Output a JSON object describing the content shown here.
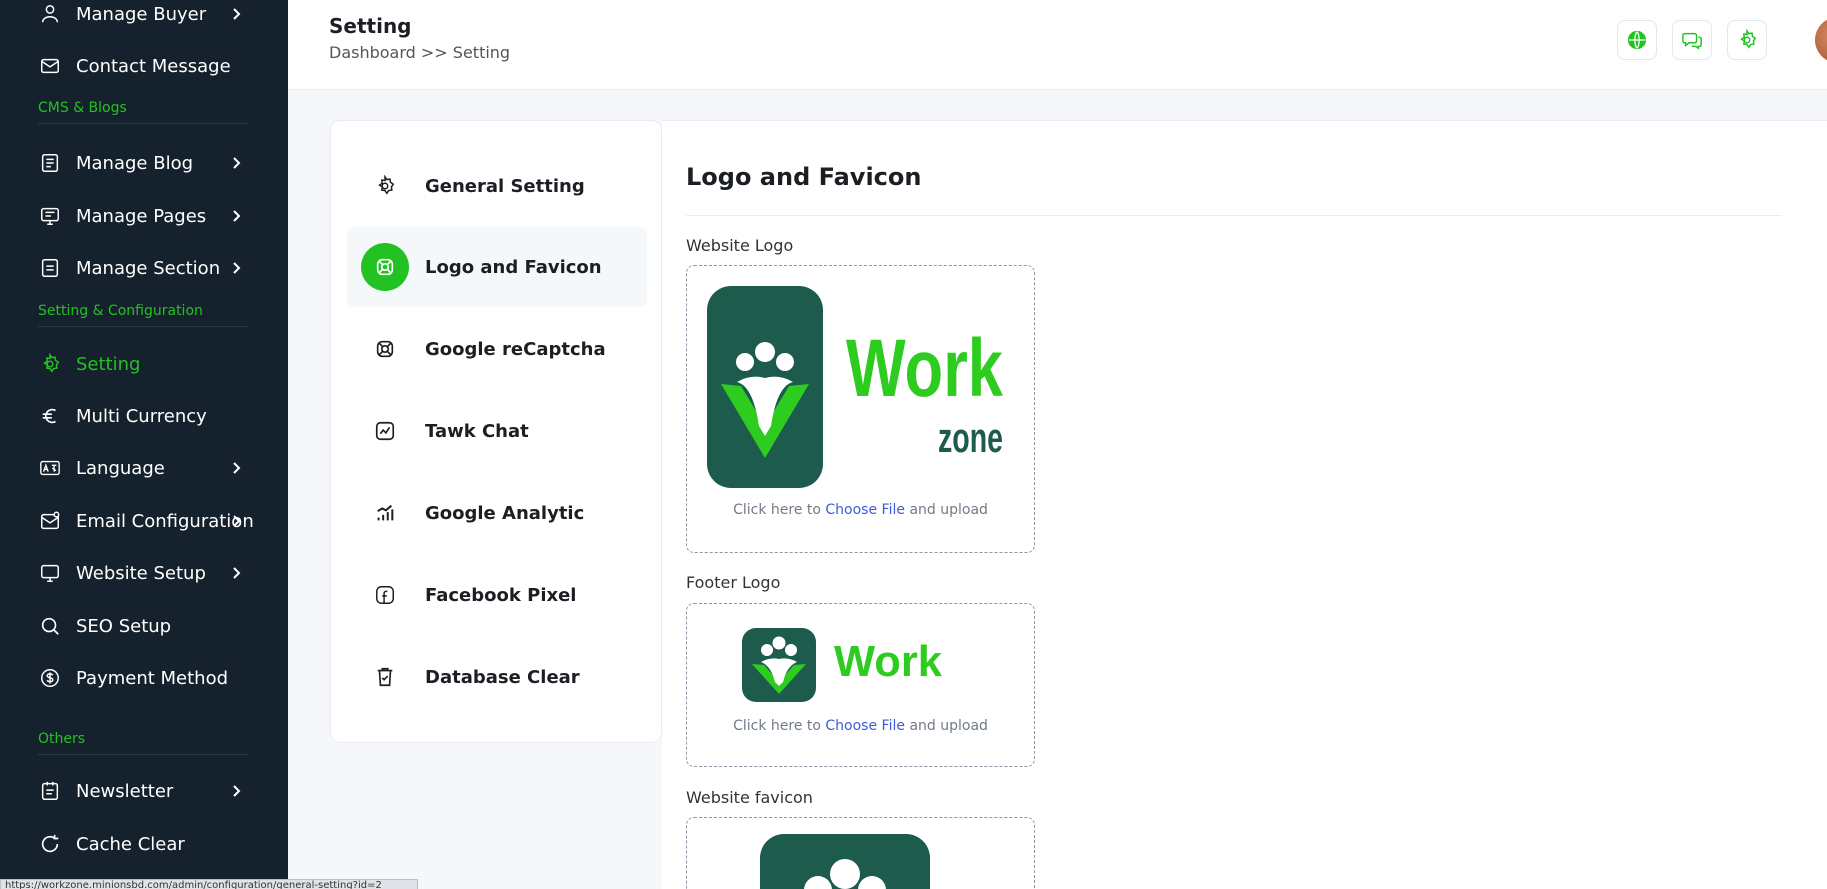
{
  "sidebar": {
    "items": [
      {
        "label": "Manage Buyer",
        "icon": "user-icon",
        "has_chevron": true
      },
      {
        "label": "Contact Message",
        "icon": "mail-icon",
        "has_chevron": false
      },
      {
        "label": "Manage Blog",
        "icon": "blog-icon",
        "has_chevron": true
      },
      {
        "label": "Manage Pages",
        "icon": "pages-icon",
        "has_chevron": true
      },
      {
        "label": "Manage Section",
        "icon": "section-icon",
        "has_chevron": true
      },
      {
        "label": "Setting",
        "icon": "gear-icon",
        "has_chevron": false,
        "active": true
      },
      {
        "label": "Multi Currency",
        "icon": "euro-icon",
        "has_chevron": false
      },
      {
        "label": "Language",
        "icon": "language-icon",
        "has_chevron": true
      },
      {
        "label": "Email Configuration",
        "icon": "email-config-icon",
        "has_chevron": true
      },
      {
        "label": "Website Setup",
        "icon": "monitor-icon",
        "has_chevron": true
      },
      {
        "label": "SEO Setup",
        "icon": "search-icon",
        "has_chevron": false
      },
      {
        "label": "Payment Method",
        "icon": "dollar-icon",
        "has_chevron": false
      },
      {
        "label": "Newsletter",
        "icon": "newsletter-icon",
        "has_chevron": true
      },
      {
        "label": "Cache Clear",
        "icon": "refresh-icon",
        "has_chevron": false
      }
    ],
    "sections": {
      "cms": "CMS & Blogs",
      "setting": "Setting & Configuration",
      "others": "Others"
    },
    "accent_color": "#22c222",
    "background_color": "#15212c"
  },
  "header": {
    "title": "Setting",
    "breadcrumb": "Dashboard >> Setting",
    "buttons": [
      "globe-icon",
      "chat-icon",
      "gear-icon"
    ]
  },
  "settings_menu": {
    "items": [
      {
        "label": "General Setting",
        "icon": "gear-icon"
      },
      {
        "label": "Logo and Favicon",
        "icon": "lifebuoy-icon",
        "active": true
      },
      {
        "label": "Google reCaptcha",
        "icon": "lifebuoy-icon"
      },
      {
        "label": "Tawk Chat",
        "icon": "chart-box-icon"
      },
      {
        "label": "Google Analytic",
        "icon": "bar-chart-icon"
      },
      {
        "label": "Facebook Pixel",
        "icon": "facebook-icon"
      },
      {
        "label": "Database Clear",
        "icon": "trash-icon"
      }
    ]
  },
  "content": {
    "title": "Logo and Favicon",
    "fields": [
      {
        "label": "Website Logo",
        "logo_word": "Work",
        "logo_sub": "zone"
      },
      {
        "label": "Footer Logo",
        "logo_word": "Work"
      },
      {
        "label": "Website favicon"
      }
    ],
    "upload_hint_pre": "Click here to",
    "upload_hint_link": "Choose File",
    "upload_hint_post": "and upload"
  },
  "statusbar": {
    "url": "https://workzone.minionsbd.com/admin/configuration/general-setting?id=2"
  }
}
